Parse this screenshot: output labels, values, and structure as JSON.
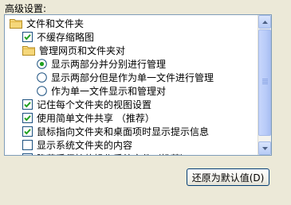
{
  "section_label": "高级设置:",
  "tree": {
    "items": [
      {
        "type": "folder",
        "label": "文件和文件夹",
        "icon": "folder-icon"
      },
      {
        "type": "checkbox",
        "label": "不缓存缩略图",
        "checked": true
      },
      {
        "type": "folder",
        "label": "管理网页和文件夹对",
        "icon": "folder-icon"
      },
      {
        "type": "radio",
        "label": "显示两部分并分别进行管理",
        "selected": true
      },
      {
        "type": "radio",
        "label": "显示两部分但是作为单一文件进行管理",
        "selected": false
      },
      {
        "type": "radio",
        "label": "作为单一文件显示和管理对",
        "selected": false
      },
      {
        "type": "checkbox",
        "label": "记住每个文件夹的视图设置",
        "checked": true
      },
      {
        "type": "checkbox",
        "label": "使用简单文件共享 （推荐）",
        "checked": true
      },
      {
        "type": "checkbox",
        "label": "鼠标指向文件夹和桌面项时显示提示信息",
        "checked": true
      },
      {
        "type": "checkbox",
        "label": "显示系统文件夹的内容",
        "checked": false
      },
      {
        "type": "checkbox",
        "label": "隐藏受保护的操作系统文件（推荐）",
        "checked": true
      }
    ]
  },
  "restore_button": {
    "label": "还原为默认值(D)"
  },
  "colors": {
    "check": "#21A121",
    "border": "#1C5180",
    "radio_dot": "#21A121"
  }
}
